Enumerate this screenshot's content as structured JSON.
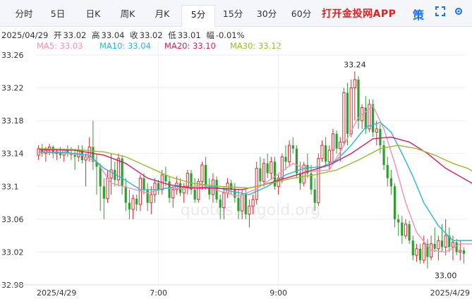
{
  "tabs": [
    {
      "label": "分时",
      "active": false
    },
    {
      "label": "5日",
      "active": false
    },
    {
      "label": "日K",
      "active": false
    },
    {
      "label": "周K",
      "active": false
    },
    {
      "label": "月K",
      "active": false
    },
    {
      "label": "5分",
      "active": true
    },
    {
      "label": "15分",
      "active": false
    },
    {
      "label": "30分",
      "active": false
    },
    {
      "label": "60分",
      "active": false
    }
  ],
  "promo": "打开金投网APP",
  "tool_icon_text": "策",
  "info": {
    "date": "2025/04/29",
    "open_label": "开",
    "open": "33.02",
    "high_label": "高",
    "high": "33.04",
    "close_label": "收",
    "close": "33.02",
    "low_label": "低",
    "low": "33.01",
    "change_label": "幅",
    "change": "-0.01%"
  },
  "ma": [
    {
      "label": "MA5: 33.03",
      "color": "#f48fb1"
    },
    {
      "label": "MA10: 33.04",
      "color": "#29b6d6"
    },
    {
      "label": "MA20: 33.10",
      "color": "#d81b60"
    },
    {
      "label": "MA30: 33.12",
      "color": "#9cb82e"
    }
  ],
  "watermark": "quotes.cngold.org",
  "chart_data": {
    "type": "candlestick",
    "up_color": "#d32f2f",
    "down_color": "#2e9e2e",
    "ylim": [
      32.98,
      33.26
    ],
    "y_ticks": [
      "33.26",
      "33.22",
      "33.18",
      "33.14",
      "33.1",
      "33.06",
      "33.02",
      "32.98"
    ],
    "y_tick_values": [
      33.26,
      33.22,
      33.18,
      33.14,
      33.1,
      33.06,
      33.02,
      32.98
    ],
    "x_ticks": [
      {
        "label": "2025/4/29",
        "index": 0
      },
      {
        "label": "7:00",
        "index": 33
      },
      {
        "label": "9:00",
        "index": 66
      },
      {
        "label": "2025/4/29",
        "index": 118
      }
    ],
    "annotations": [
      {
        "label": "33.24",
        "index": 87,
        "value": 33.24
      },
      {
        "label": "33.00",
        "index": 112,
        "value": 33.0
      }
    ],
    "candles": [
      [
        33.138,
        33.15,
        33.132,
        33.146
      ],
      [
        33.146,
        33.152,
        33.136,
        33.14
      ],
      [
        33.14,
        33.148,
        33.13,
        33.144
      ],
      [
        33.144,
        33.152,
        33.138,
        33.148
      ],
      [
        33.148,
        33.15,
        33.134,
        33.14
      ],
      [
        33.14,
        33.146,
        33.132,
        33.142
      ],
      [
        33.142,
        33.148,
        33.134,
        33.138
      ],
      [
        33.138,
        33.146,
        33.13,
        33.144
      ],
      [
        33.144,
        33.15,
        33.136,
        33.14
      ],
      [
        33.14,
        33.148,
        33.132,
        33.138
      ],
      [
        33.138,
        33.144,
        33.12,
        33.136
      ],
      [
        33.136,
        33.15,
        33.13,
        33.144
      ],
      [
        33.144,
        33.15,
        33.128,
        33.132
      ],
      [
        33.132,
        33.14,
        33.1,
        33.136
      ],
      [
        33.136,
        33.16,
        33.13,
        33.148
      ],
      [
        33.148,
        33.18,
        33.12,
        33.13
      ],
      [
        33.13,
        33.14,
        33.09,
        33.124
      ],
      [
        33.124,
        33.128,
        33.07,
        33.1
      ],
      [
        33.1,
        33.11,
        33.06,
        33.085
      ],
      [
        33.085,
        33.12,
        33.08,
        33.11
      ],
      [
        33.11,
        33.14,
        33.09,
        33.12
      ],
      [
        33.12,
        33.13,
        33.1,
        33.108
      ],
      [
        33.108,
        33.14,
        33.1,
        33.134
      ],
      [
        33.134,
        33.138,
        33.09,
        33.1
      ],
      [
        33.1,
        33.11,
        33.07,
        33.08
      ],
      [
        33.08,
        33.096,
        33.06,
        33.072
      ],
      [
        33.072,
        33.09,
        33.06,
        33.085
      ],
      [
        33.085,
        33.09,
        33.07,
        33.078
      ],
      [
        33.078,
        33.114,
        33.07,
        33.11
      ],
      [
        33.11,
        33.116,
        33.09,
        33.096
      ],
      [
        33.096,
        33.104,
        33.07,
        33.08
      ],
      [
        33.08,
        33.1,
        33.066,
        33.09
      ],
      [
        33.09,
        33.11,
        33.08,
        33.104
      ],
      [
        33.104,
        33.108,
        33.09,
        33.096
      ],
      [
        33.096,
        33.12,
        33.09,
        33.114
      ],
      [
        33.114,
        33.124,
        33.1,
        33.106
      ],
      [
        33.106,
        33.112,
        33.08,
        33.086
      ],
      [
        33.086,
        33.1,
        33.074,
        33.096
      ],
      [
        33.096,
        33.112,
        33.09,
        33.104
      ],
      [
        33.104,
        33.11,
        33.088,
        33.092
      ],
      [
        33.092,
        33.104,
        33.08,
        33.1
      ],
      [
        33.1,
        33.12,
        33.09,
        33.116
      ],
      [
        33.116,
        33.12,
        33.09,
        33.096
      ],
      [
        33.096,
        33.11,
        33.08,
        33.084
      ],
      [
        33.084,
        33.11,
        33.08,
        33.106
      ],
      [
        33.106,
        33.13,
        33.096,
        33.126
      ],
      [
        33.126,
        33.136,
        33.096,
        33.1
      ],
      [
        33.1,
        33.11,
        33.084,
        33.09
      ],
      [
        33.09,
        33.116,
        33.08,
        33.108
      ],
      [
        33.108,
        33.112,
        33.08,
        33.084
      ],
      [
        33.084,
        33.09,
        33.06,
        33.074
      ],
      [
        33.074,
        33.1,
        33.06,
        33.092
      ],
      [
        33.092,
        33.11,
        33.086,
        33.104
      ],
      [
        33.104,
        33.108,
        33.09,
        33.096
      ],
      [
        33.096,
        33.104,
        33.08,
        33.086
      ],
      [
        33.086,
        33.096,
        33.06,
        33.07
      ],
      [
        33.07,
        33.096,
        33.06,
        33.09
      ],
      [
        33.09,
        33.096,
        33.06,
        33.066
      ],
      [
        33.066,
        33.084,
        33.05,
        33.076
      ],
      [
        33.076,
        33.09,
        33.066,
        33.084
      ],
      [
        33.084,
        33.13,
        33.078,
        33.122
      ],
      [
        33.122,
        33.136,
        33.1,
        33.106
      ],
      [
        33.106,
        33.134,
        33.1,
        33.128
      ],
      [
        33.128,
        33.14,
        33.11,
        33.116
      ],
      [
        33.116,
        33.136,
        33.108,
        33.13
      ],
      [
        33.13,
        33.136,
        33.096,
        33.1
      ],
      [
        33.1,
        33.114,
        33.09,
        33.11
      ],
      [
        33.11,
        33.14,
        33.104,
        33.136
      ],
      [
        33.136,
        33.15,
        33.12,
        33.13
      ],
      [
        33.13,
        33.156,
        33.124,
        33.15
      ],
      [
        33.15,
        33.16,
        33.14,
        33.146
      ],
      [
        33.146,
        33.15,
        33.11,
        33.116
      ],
      [
        33.116,
        33.13,
        33.096,
        33.104
      ],
      [
        33.104,
        33.13,
        33.1,
        33.126
      ],
      [
        33.126,
        33.14,
        33.11,
        33.116
      ],
      [
        33.116,
        33.126,
        33.09,
        33.096
      ],
      [
        33.096,
        33.11,
        33.07,
        33.08
      ],
      [
        33.08,
        33.14,
        33.076,
        33.134
      ],
      [
        33.134,
        33.156,
        33.13,
        33.15
      ],
      [
        33.15,
        33.16,
        33.124,
        33.13
      ],
      [
        33.13,
        33.15,
        33.12,
        33.144
      ],
      [
        33.144,
        33.17,
        33.13,
        33.164
      ],
      [
        33.164,
        33.168,
        33.14,
        33.146
      ],
      [
        33.146,
        33.16,
        33.13,
        33.154
      ],
      [
        33.154,
        33.22,
        33.15,
        33.214
      ],
      [
        33.214,
        33.226,
        33.15,
        33.164
      ],
      [
        33.164,
        33.23,
        33.16,
        33.22
      ],
      [
        33.22,
        33.24,
        33.18,
        33.23
      ],
      [
        33.23,
        33.234,
        33.17,
        33.18
      ],
      [
        33.18,
        33.2,
        33.17,
        33.196
      ],
      [
        33.196,
        33.21,
        33.164,
        33.17
      ],
      [
        33.17,
        33.206,
        33.166,
        33.2
      ],
      [
        33.2,
        33.206,
        33.16,
        33.166
      ],
      [
        33.166,
        33.18,
        33.15,
        33.17
      ],
      [
        33.17,
        33.176,
        33.14,
        33.15
      ],
      [
        33.15,
        33.156,
        33.12,
        33.126
      ],
      [
        33.126,
        33.136,
        33.1,
        33.11
      ],
      [
        33.11,
        33.12,
        33.09,
        33.1
      ],
      [
        33.1,
        33.104,
        33.05,
        33.06
      ],
      [
        33.06,
        33.066,
        33.04,
        33.056
      ],
      [
        33.056,
        33.064,
        33.03,
        33.04
      ],
      [
        33.04,
        33.06,
        33.036,
        33.054
      ],
      [
        33.054,
        33.058,
        33.03,
        33.034
      ],
      [
        33.034,
        33.04,
        33.01,
        33.016
      ],
      [
        33.016,
        33.03,
        33.008,
        33.024
      ],
      [
        33.024,
        33.03,
        33.006,
        33.01
      ],
      [
        33.01,
        33.04,
        33.006,
        33.03
      ],
      [
        33.03,
        33.036,
        33.0,
        33.014
      ],
      [
        33.014,
        33.04,
        33.01,
        33.03
      ],
      [
        33.03,
        33.05,
        33.02,
        33.024
      ],
      [
        33.024,
        33.04,
        33.01,
        33.034
      ],
      [
        33.034,
        33.054,
        33.02,
        33.026
      ],
      [
        33.026,
        33.06,
        33.016,
        33.04
      ],
      [
        33.04,
        33.05,
        33.02,
        33.026
      ],
      [
        33.026,
        33.04,
        33.01,
        33.032
      ],
      [
        33.032,
        33.036,
        33.016,
        33.02
      ],
      [
        33.02,
        33.034,
        33.01,
        33.022
      ],
      [
        33.022,
        33.026,
        33.006,
        33.018
      ]
    ],
    "ma_series": [
      {
        "label": "MA5",
        "color": "#f48fb1",
        "values": [
          [
            0,
            33.141
          ],
          [
            6,
            33.141
          ],
          [
            12,
            33.138
          ],
          [
            16,
            33.13
          ],
          [
            20,
            33.104
          ],
          [
            25,
            33.098
          ],
          [
            30,
            33.092
          ],
          [
            35,
            33.098
          ],
          [
            40,
            33.097
          ],
          [
            45,
            33.102
          ],
          [
            50,
            33.094
          ],
          [
            55,
            33.088
          ],
          [
            60,
            33.097
          ],
          [
            65,
            33.112
          ],
          [
            70,
            33.128
          ],
          [
            75,
            33.118
          ],
          [
            80,
            33.12
          ],
          [
            84,
            33.15
          ],
          [
            88,
            33.184
          ],
          [
            92,
            33.198
          ],
          [
            95,
            33.17
          ],
          [
            98,
            33.128
          ],
          [
            101,
            33.08
          ],
          [
            104,
            33.044
          ],
          [
            108,
            33.022
          ],
          [
            112,
            33.02
          ],
          [
            116,
            33.03
          ],
          [
            120,
            33.03
          ]
        ]
      },
      {
        "label": "MA10",
        "color": "#29b6d6",
        "values": [
          [
            0,
            33.142
          ],
          [
            8,
            33.141
          ],
          [
            14,
            33.138
          ],
          [
            18,
            33.122
          ],
          [
            23,
            33.11
          ],
          [
            28,
            33.096
          ],
          [
            33,
            33.096
          ],
          [
            38,
            33.1
          ],
          [
            43,
            33.098
          ],
          [
            48,
            33.1
          ],
          [
            53,
            33.094
          ],
          [
            58,
            33.09
          ],
          [
            63,
            33.1
          ],
          [
            68,
            33.114
          ],
          [
            73,
            33.122
          ],
          [
            78,
            33.124
          ],
          [
            82,
            33.132
          ],
          [
            86,
            33.15
          ],
          [
            90,
            33.172
          ],
          [
            94,
            33.178
          ],
          [
            97,
            33.166
          ],
          [
            100,
            33.14
          ],
          [
            103,
            33.112
          ],
          [
            106,
            33.08
          ],
          [
            110,
            33.052
          ],
          [
            114,
            33.034
          ],
          [
            120,
            33.034
          ]
        ]
      },
      {
        "label": "MA20",
        "color": "#d81b60",
        "values": [
          [
            0,
            33.145
          ],
          [
            10,
            33.144
          ],
          [
            18,
            33.138
          ],
          [
            24,
            33.128
          ],
          [
            30,
            33.11
          ],
          [
            36,
            33.102
          ],
          [
            42,
            33.098
          ],
          [
            48,
            33.098
          ],
          [
            56,
            33.096
          ],
          [
            62,
            33.102
          ],
          [
            68,
            33.11
          ],
          [
            74,
            33.118
          ],
          [
            80,
            33.126
          ],
          [
            86,
            33.14
          ],
          [
            92,
            33.158
          ],
          [
            97,
            33.16
          ],
          [
            102,
            33.154
          ],
          [
            107,
            33.14
          ],
          [
            112,
            33.122
          ],
          [
            116,
            33.112
          ],
          [
            120,
            33.102
          ]
        ]
      },
      {
        "label": "MA30",
        "color": "#9cb82e",
        "values": [
          [
            0,
            33.146
          ],
          [
            10,
            33.145
          ],
          [
            18,
            33.142
          ],
          [
            24,
            33.136
          ],
          [
            30,
            33.124
          ],
          [
            36,
            33.112
          ],
          [
            42,
            33.104
          ],
          [
            50,
            33.1
          ],
          [
            58,
            33.098
          ],
          [
            64,
            33.104
          ],
          [
            70,
            33.11
          ],
          [
            76,
            33.114
          ],
          [
            82,
            33.12
          ],
          [
            88,
            33.132
          ],
          [
            94,
            33.146
          ],
          [
            99,
            33.15
          ],
          [
            104,
            33.146
          ],
          [
            109,
            33.138
          ],
          [
            114,
            33.128
          ],
          [
            118,
            33.122
          ],
          [
            120,
            33.117
          ]
        ]
      }
    ]
  }
}
